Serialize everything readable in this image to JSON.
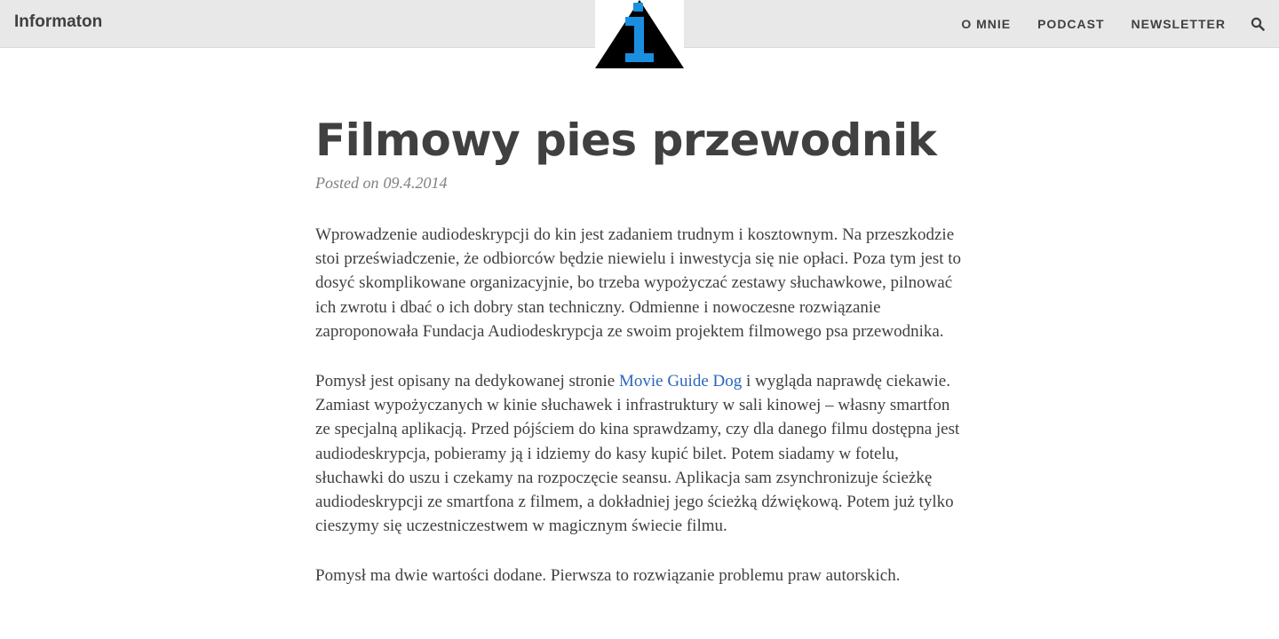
{
  "site": {
    "brand": "Informaton",
    "nav": {
      "items": [
        "O MNIE",
        "PODCAST",
        "NEWSLETTER"
      ],
      "search_icon": "search-icon"
    },
    "logo": {
      "icon": "info-triangle-logo",
      "colors": {
        "triangle": "#000000",
        "glyph": "#1a8fe0"
      }
    }
  },
  "post": {
    "title": "Filmowy pies przewodnik",
    "posted_label": "Posted on",
    "date": "09.4.2014",
    "paragraph1": "Wprowadzenie audiodeskrypcji do kin jest zadaniem trudnym i kosztownym. Na przeszkodzie stoi przeświadczenie, że odbiorców będzie niewielu i inwestycja się nie opłaci. Poza tym jest to dosyć skomplikowane organizacyjnie, bo trzeba wypożyczać zestawy słuchawkowe, pilnować ich zwrotu i dbać o ich dobry stan techniczny. Odmienne i nowoczesne rozwiązanie zaproponowała Fundacja Audiodeskrypcja ze swoim projektem filmowego psa przewodnika.",
    "paragraph2": {
      "before": "Pomysł jest opisany na dedykowanej stronie ",
      "link": "Movie Guide Dog",
      "after": " i wygląda naprawdę ciekawie. Zamiast wypożyczanych w kinie słuchawek i infrastruktury w sali kinowej – własny smartfon ze specjalną aplikacją. Przed pójściem do kina sprawdzamy, czy dla danego filmu dostępna jest audiodeskrypcja, pobieramy ją i idziemy do kasy kupić bilet. Potem siadamy w fotelu, słuchawki do uszu i czekamy na rozpoczęcie seansu. Aplikacja sam zsynchronizuje ścieżkę audiodeskrypcji ze smartfona z filmem, a dokładniej jego ścieżką dźwiękową. Potem już tylko cieszymy się uczestniczestwem w magicznym świecie filmu."
    },
    "paragraph3": "Pomysł ma dwie wartości dodane. Pierwsza to rozwiązanie problemu praw autorskich."
  },
  "colors": {
    "topbar_bg": "#e8e8e8",
    "text": "#404040",
    "meta": "#808080",
    "link": "#2b66b8"
  }
}
